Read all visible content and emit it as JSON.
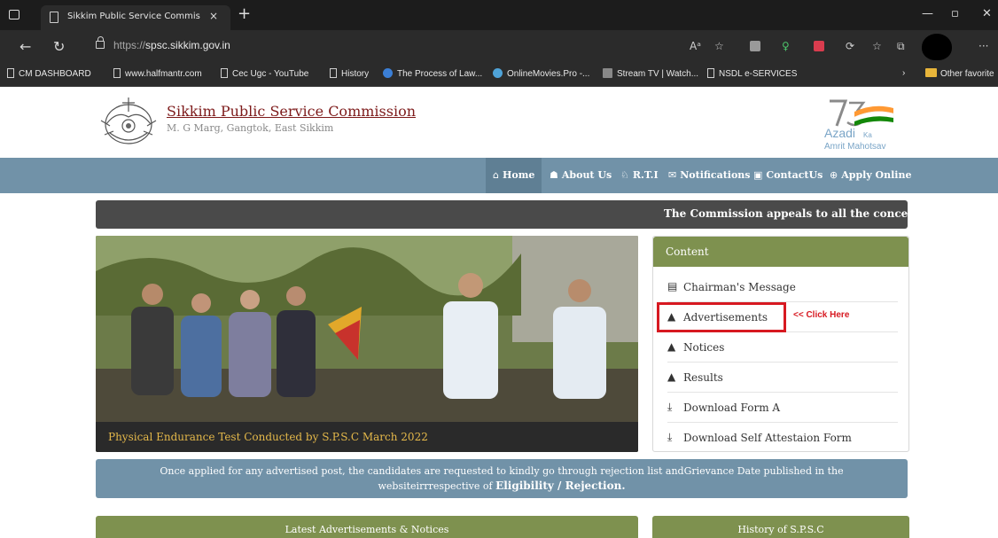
{
  "browser": {
    "tab_title": "Sikkim Public Service Commissio",
    "tab_close": "×",
    "new_tab": "+",
    "url_scheme": "https://",
    "url_host": "spsc.sikkim.gov.in",
    "bookmarks": [
      {
        "label": "CM DASHBOARD",
        "icon": "page-icon"
      },
      {
        "label": "www.halfmantr.com",
        "icon": "page-icon"
      },
      {
        "label": "Cec Ugc - YouTube",
        "icon": "page-icon"
      },
      {
        "label": "History",
        "icon": "page-icon"
      },
      {
        "label": "The Process of Law...",
        "icon": "globe-icon"
      },
      {
        "label": "OnlineMovies.Pro -...",
        "icon": "movie-icon"
      },
      {
        "label": "Stream TV | Watch...",
        "icon": "tv-icon"
      },
      {
        "label": "NSDL e-SERVICES",
        "icon": "page-icon"
      }
    ],
    "other_favorites": "Other favorite"
  },
  "header": {
    "title": "Sikkim Public Service Commission",
    "subtitle": "M. G Marg, Gangtok, East Sikkim",
    "azadi_line1": "Azadi",
    "azadi_ka": "Ka",
    "azadi_line2": "Amrit Mahotsav"
  },
  "nav": {
    "items": [
      {
        "label": "Home",
        "icon": "home-icon"
      },
      {
        "label": "About Us",
        "icon": "users-icon"
      },
      {
        "label": "R.T.I",
        "icon": "award-icon"
      },
      {
        "label": "Notifications",
        "icon": "envelope-icon"
      },
      {
        "label": "ContactUs",
        "icon": "contact-icon"
      },
      {
        "label": "Apply Online",
        "icon": "globe-icon"
      }
    ]
  },
  "marquee": "The Commission appeals to all the concerned t",
  "slider": {
    "caption": "Physical Endurance Test Conducted by S.P.S.C March 2022"
  },
  "content": {
    "heading": "Content",
    "items": [
      {
        "label": "Chairman's Message",
        "icon": "chairman-icon"
      },
      {
        "label": "Advertisements",
        "icon": "arrow-icon"
      },
      {
        "label": "Notices",
        "icon": "arrow-icon"
      },
      {
        "label": "Results",
        "icon": "arrow-icon"
      },
      {
        "label": "Download Form A",
        "icon": "download-icon"
      },
      {
        "label": "Download Self Attestaion Form",
        "icon": "download-icon"
      }
    ],
    "click_note": "<< Click Here"
  },
  "notice": {
    "line1": "Once applied for any advertised post, the candidates are requested to kindly go through rejection list andGrievance Date published in the",
    "line2_prefix": "websiteirrrespective of ",
    "line2_bold": "Eligibility / Rejection."
  },
  "sections": {
    "latest": "Latest Advertisements & Notices",
    "history": "History of S.P.S.C"
  },
  "colors": {
    "nav_bg": "#7192a8",
    "panel_green": "#7e914f",
    "title_maroon": "#7d1a1a",
    "caption_gold": "#e4b84a",
    "highlight_red": "#d71921"
  }
}
